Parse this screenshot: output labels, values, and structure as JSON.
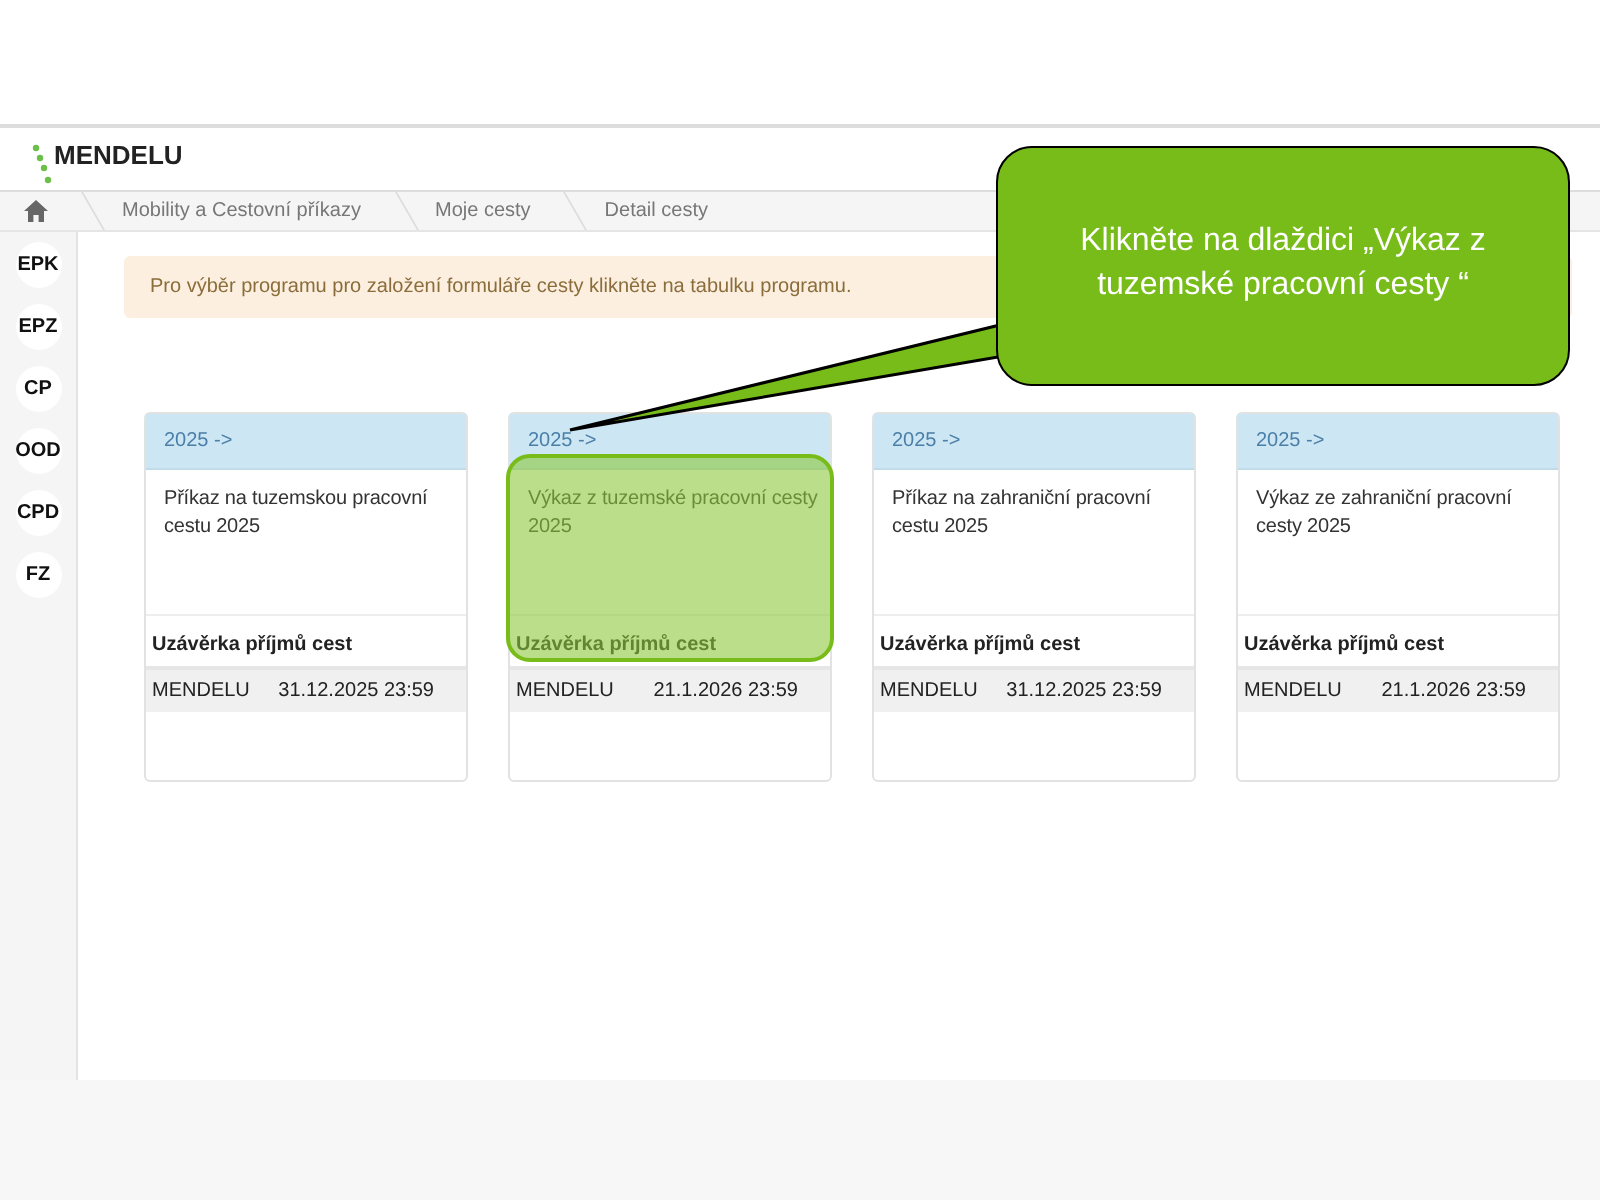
{
  "header": {
    "logo": "MENDELU"
  },
  "breadcrumb": [
    "Mobility a Cestovní příkazy",
    "Moje cesty",
    "Detail cesty"
  ],
  "sidebar": {
    "items": [
      "EPK",
      "EPZ",
      "CP",
      "OOD",
      "CPD",
      "FZ"
    ]
  },
  "alert": "Pro výběr programu pro založení formuláře cesty klikněte na tabulku programu.",
  "cards": [
    {
      "header": "2025 ->",
      "title": "Příkaz na tuzemskou pracovní cestu 2025",
      "section": "Uzávěrka příjmů cest",
      "org": "MENDELU",
      "deadline": "31.12.2025 23:59",
      "highlighted": false
    },
    {
      "header": "2025 ->",
      "title": "Výkaz z tuzemské pracovní cesty 2025",
      "section": "Uzávěrka příjmů cest",
      "org": "MENDELU",
      "deadline": "21.1.2026 23:59",
      "highlighted": true
    },
    {
      "header": "2025 ->",
      "title": "Příkaz na zahraniční pracovní cestu 2025",
      "section": "Uzávěrka příjmů cest",
      "org": "MENDELU",
      "deadline": "31.12.2025 23:59",
      "highlighted": false
    },
    {
      "header": "2025 ->",
      "title": "Výkaz ze zahraniční pracovní cesty 2025",
      "section": "Uzávěrka příjmů cest",
      "org": "MENDELU",
      "deadline": "21.1.2026 23:59",
      "highlighted": false
    }
  ],
  "callout": "Klikněte na dlaždici „Výkaz z tuzemské pracovní cesty “"
}
